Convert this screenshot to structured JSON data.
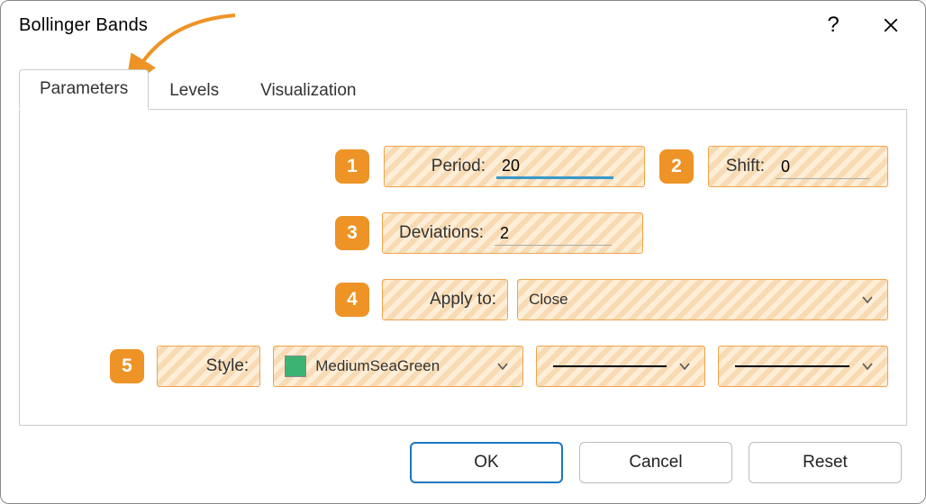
{
  "window": {
    "title": "Bollinger Bands"
  },
  "tabs": {
    "parameters": "Parameters",
    "levels": "Levels",
    "visualization": "Visualization",
    "active": "parameters"
  },
  "markers": {
    "m1": "1",
    "m2": "2",
    "m3": "3",
    "m4": "4",
    "m5": "5"
  },
  "fields": {
    "period": {
      "label": "Period:",
      "value": "20"
    },
    "shift": {
      "label": "Shift:",
      "value": "0"
    },
    "deviations": {
      "label": "Deviations:",
      "value": "2"
    },
    "apply_to": {
      "label": "Apply to:",
      "selected": "Close"
    },
    "style": {
      "label": "Style:",
      "color_name": "MediumSeaGreen",
      "color_hex": "#3cb371"
    }
  },
  "buttons": {
    "ok": "OK",
    "cancel": "Cancel",
    "reset": "Reset"
  },
  "colors": {
    "annotation_orange": "#ee9326",
    "highlight_orange_border": "#f0a44a",
    "highlight_fill_light": "#fdeed7",
    "highlight_fill_dark": "#f8dab3",
    "primary_blue": "#1b76c4",
    "input_active_underline": "#3b97c9"
  }
}
